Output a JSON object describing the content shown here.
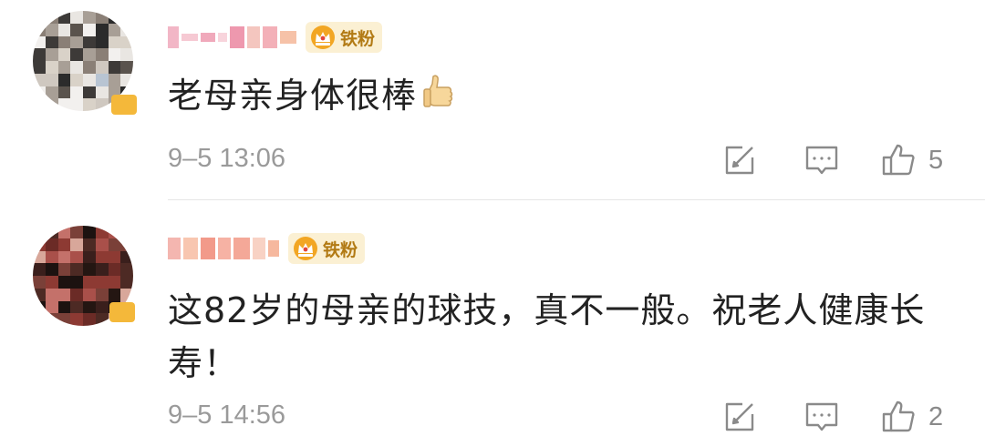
{
  "comments": [
    {
      "badge": "铁粉",
      "text": "老母亲身体很棒",
      "emoji": "thumbs-up",
      "timestamp": "9–5 13:06",
      "likes": "5"
    },
    {
      "badge": "铁粉",
      "text": "这82岁的母亲的球技，真不一般。祝老人健康长寿！",
      "timestamp": "9–5 14:56",
      "likes": "2"
    }
  ],
  "colors": {
    "text": "#222222",
    "meta": "#9a9a9a",
    "badge_bg": "#fbf0d3",
    "badge_text": "#b27a14",
    "vip": "#f4b83a"
  },
  "icons": [
    "share-icon",
    "reply-icon",
    "like-icon",
    "crown-icon",
    "thumbs-up-emoji"
  ]
}
